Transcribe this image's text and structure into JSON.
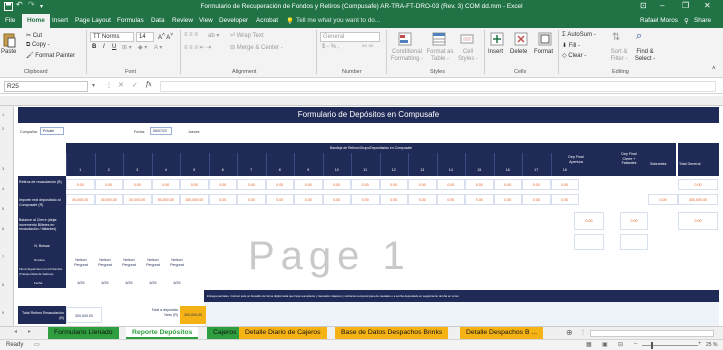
{
  "window": {
    "title": "Formulario de Recuperación de Fondos y Retiros (Compusafe) AR-TRA-FT-DRO-03 (Rev. 3) COM dd.mm - Excel",
    "user": "Rafael Moros",
    "share": "Share"
  },
  "ribbon_tabs": [
    "File",
    "Home",
    "Insert",
    "Page Layout",
    "Formulas",
    "Data",
    "Review",
    "View",
    "Developer",
    "Acrobat"
  ],
  "tell_me": "Tell me what you want to do...",
  "clipboard": {
    "paste": "Paste",
    "cut": "Cut",
    "copy": "Copy -",
    "format_painter": "Format Painter",
    "label": "Clipboard"
  },
  "font": {
    "name": "TT Norms",
    "size": "14",
    "label": "Font"
  },
  "alignment": {
    "wrap": "Wrap Text",
    "merge": "Merge & Center -",
    "label": "Alignment"
  },
  "number": {
    "format": "General",
    "currency": "$ - % ,",
    "label": "Number"
  },
  "styles": {
    "cond": "Conditional Formatting -",
    "table": "Format as Table -",
    "cell": "Cell Styles -",
    "label": "Styles"
  },
  "cells": {
    "insert": "Insert",
    "delete": "Delete",
    "format": "Format",
    "label": "Cells"
  },
  "editing": {
    "autosum": "AutoSum -",
    "fill": "Fill -",
    "clear": "Clear -",
    "sort": "Sort & Filter -",
    "find": "Find & Select -",
    "label": "Editing"
  },
  "formula_bar": {
    "name_box": "R25",
    "fx": "fx",
    "value": ""
  },
  "sheet": {
    "title": "Formulario de Depósitos en Compusafe",
    "company_label": "Compañía:",
    "company_value": "Private",
    "date_label": "Fecha:",
    "date_value": "06/07/22",
    "day_value": "Jueves",
    "bin_header": "Bandeja de Retiros/Grupo/Depositados en Compusafe",
    "columns": [
      "1",
      "2",
      "3",
      "4",
      "5",
      "6",
      "7",
      "8",
      "9",
      "10",
      "11",
      "12",
      "13",
      "14",
      "15",
      "16",
      "17",
      "18"
    ],
    "col_apertura": "Dep Final Apertura",
    "col_final": "Dep Final Cierre + Faltantes",
    "col_sobrantes": "Sobrantes",
    "col_total": "Total General",
    "row1_label": "Retiros de recaudación (B)",
    "row1_values": [
      "0.00",
      "0.00",
      "0.00",
      "0.00",
      "0.00",
      "0.00",
      "0.00",
      "0.00",
      "0.00",
      "0.00",
      "0.00",
      "0.00",
      "0.00",
      "0.00",
      "0.00",
      "0.00",
      "0.00",
      "0.00"
    ],
    "row1_total": "0.00",
    "row2_label": "Importe real depositado al Compusafe (R)",
    "row2_values": [
      "40,000.00",
      "40,000.00",
      "20,000.00",
      "50,000.00",
      "150,000.00",
      "0.00",
      "0.00",
      "0.00",
      "0.00",
      "0.00",
      "0.00",
      "0.00",
      "0.00",
      "0.00",
      "0.00",
      "0.00",
      "0.00",
      "0.00"
    ],
    "row2_sob": "0.00",
    "row2_total": "300,000.00",
    "row3_label": "Balance al Cierre (dejar incremento Billetes en recaudación / faltantes)",
    "row3_vals": [
      "0.00",
      "0.00",
      "0.00"
    ],
    "row4_label": "N. Bolsas",
    "row5_label": "Nombre",
    "row6_label": "Firma Supervisor con Id Nombre (Transportista de Valores)",
    "row7_label": "Fecha",
    "people": [
      "Nelson Pergurat",
      "Nelson Pergurat",
      "Nelson Pergurat",
      "Nelson Pergurat",
      "Nelson Pergurat"
    ],
    "people_dates": [
      "6/25",
      "6/25",
      "6/25",
      "6/25",
      "6/25"
    ],
    "watermark": "Page 1",
    "notice": "Entrega parciales. Colocar para un llenadito de forma digital cada que haya reemplazar y depositar colapsos y sobrantes temporal para de caudales o a ser/ha depositado en seguimiento del día en curso",
    "bottom_label1": "Total Retiros Recaudación (B)",
    "bottom_val1": "300,000.00",
    "bottom_label2": "Total a depositar Neto (R)",
    "bottom_val2": "300,000.00"
  },
  "sheet_tabs": [
    "Formulario Llenado",
    "Reporte Depósitos",
    "Cajeros",
    "Detalle Diario de Cajeros",
    "Base de Datos Despachos Brinks",
    "Detalle Despachos B ..."
  ],
  "status": {
    "ready": "Ready",
    "zoom": "25 %"
  },
  "colors": {
    "excel_green": "#217346",
    "navy": "#1f2a56",
    "tab_green": "#2e9e3e",
    "tab_orange": "#f5b214",
    "value_orange": "#e25b25"
  }
}
